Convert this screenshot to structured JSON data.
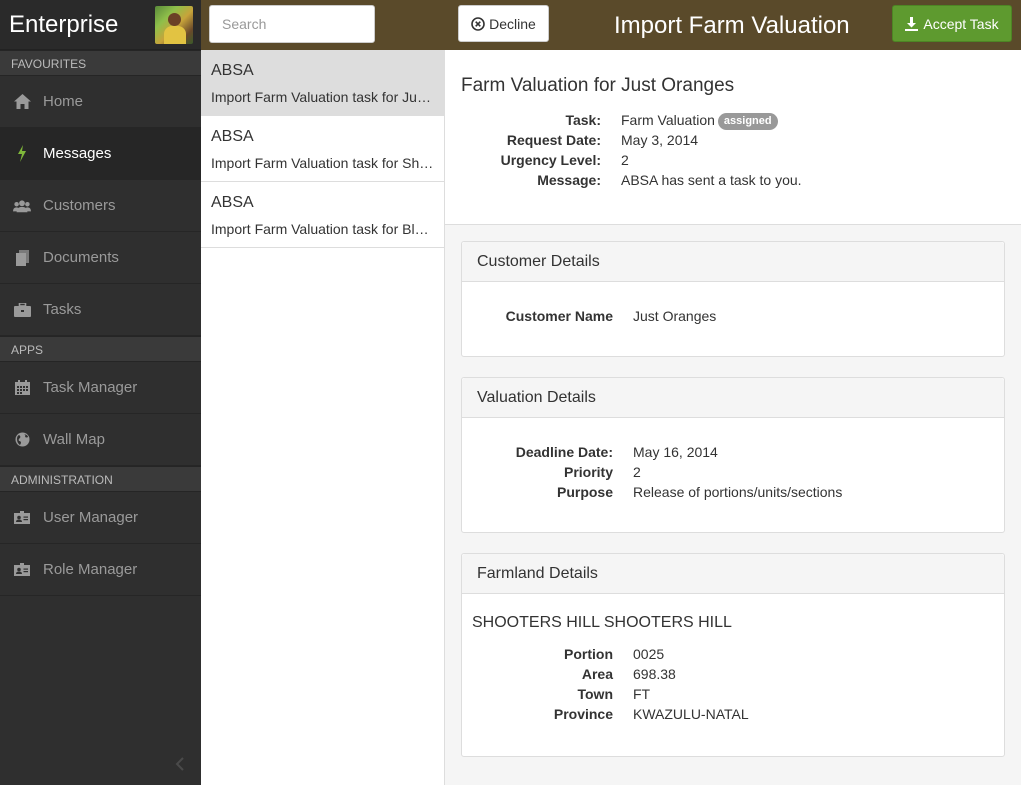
{
  "sidebar": {
    "brand": "Enterprise",
    "favourites_label": "FAVOURITES",
    "apps_label": "APPS",
    "administration_label": "ADMINISTRATION",
    "items": [
      {
        "label": "Home",
        "icon": "home-icon"
      },
      {
        "label": "Messages",
        "icon": "bolt-icon"
      },
      {
        "label": "Customers",
        "icon": "users-icon"
      },
      {
        "label": "Documents",
        "icon": "documents-icon"
      },
      {
        "label": "Tasks",
        "icon": "briefcase-icon"
      }
    ],
    "apps": [
      {
        "label": "Task Manager",
        "icon": "calendar-icon"
      },
      {
        "label": "Wall Map",
        "icon": "globe-icon"
      }
    ],
    "admin": [
      {
        "label": "User Manager",
        "icon": "id-card-icon"
      },
      {
        "label": "Role Manager",
        "icon": "id-card-icon"
      }
    ]
  },
  "search": {
    "placeholder": "Search"
  },
  "toolbar": {
    "decline_label": "Decline",
    "title": "Import Farm Valuation",
    "accept_label": "Accept Task"
  },
  "messages": [
    {
      "from": "ABSA",
      "preview": "Import Farm Valuation task for Just Oranges"
    },
    {
      "from": "ABSA",
      "preview": "Import Farm Valuation task for Shooters Hill"
    },
    {
      "from": "ABSA",
      "preview": "Import Farm Valuation task for Blue Gum"
    }
  ],
  "detail": {
    "heading": "Farm Valuation for Just Oranges",
    "task_label": "Task:",
    "task_value": "Farm Valuation",
    "task_badge": "assigned",
    "request_date_label": "Request Date:",
    "request_date_value": "May 3, 2014",
    "urgency_label": "Urgency Level:",
    "urgency_value": "2",
    "message_label": "Message:",
    "message_value": "ABSA has sent a task to you."
  },
  "customer_details": {
    "title": "Customer Details",
    "name_label": "Customer Name",
    "name_value": "Just Oranges"
  },
  "valuation_details": {
    "title": "Valuation Details",
    "deadline_label": "Deadline Date:",
    "deadline_value": "May 16, 2014",
    "priority_label": "Priority",
    "priority_value": "2",
    "purpose_label": "Purpose",
    "purpose_value": "Release of portions/units/sections"
  },
  "farmland_details": {
    "title": "Farmland Details",
    "farm_name": "SHOOTERS HILL SHOOTERS HILL",
    "portion_label": "Portion",
    "portion_value": "0025",
    "area_label": "Area",
    "area_value": "698.38",
    "town_label": "Town",
    "town_value": "FT",
    "province_label": "Province",
    "province_value": "KWAZULU-NATAL"
  },
  "colors": {
    "header_bg": "#5a4a2a",
    "sidebar_bg": "#2f2f2f",
    "accept_green": "#5e9a2f",
    "active_icon": "#7fb83a"
  }
}
